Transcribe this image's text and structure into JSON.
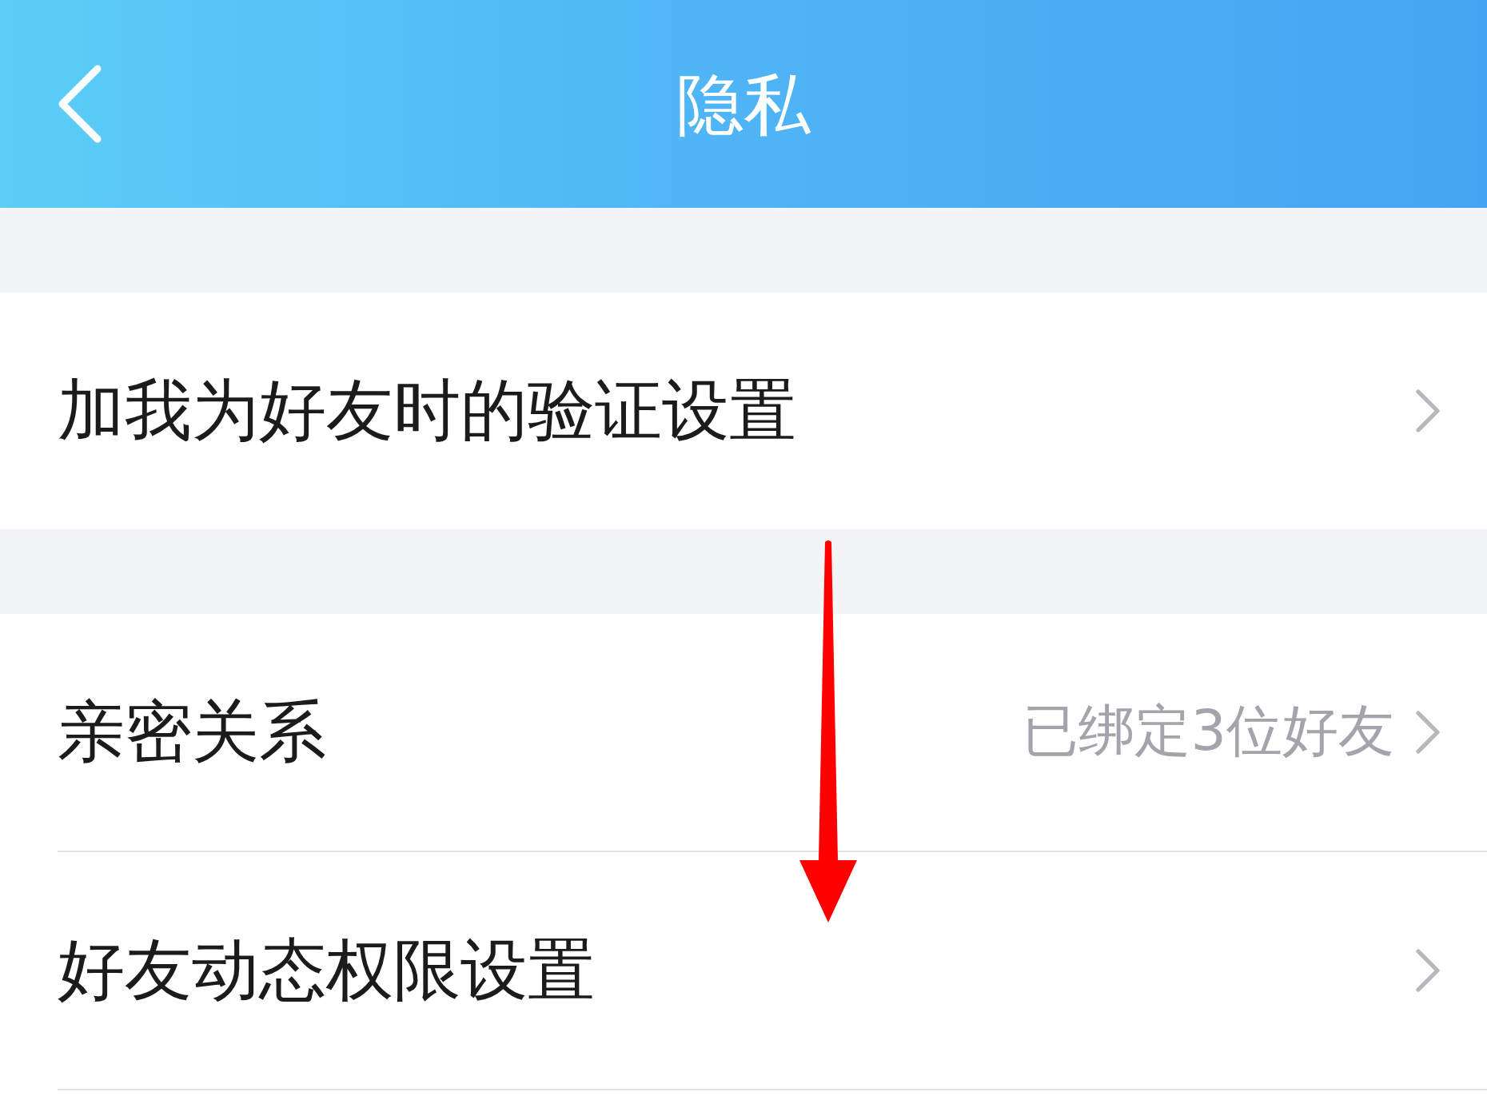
{
  "header": {
    "title": "隐私"
  },
  "sections": [
    {
      "rows": [
        {
          "label": "加我为好友时的验证设置"
        }
      ]
    },
    {
      "rows": [
        {
          "label": "亲密关系",
          "value": "已绑定3位好友"
        },
        {
          "label": "好友动态权限设置"
        }
      ]
    }
  ]
}
